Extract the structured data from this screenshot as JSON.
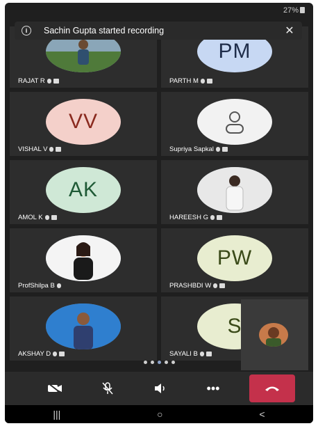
{
  "status": {
    "battery": "27%"
  },
  "banner": {
    "text": "Sachin Gupta started recording",
    "info_icon": "info-icon",
    "close_icon": "close-icon"
  },
  "colors": {
    "background": "#1f1f1f",
    "tile": "#2d2d2d",
    "end_call": "#c4314b"
  },
  "participants": [
    {
      "name": "RAJAT R",
      "avatar": "photo"
    },
    {
      "name": "PARTH M",
      "initials": "PM",
      "bg": "#c7d8f3",
      "fg": "#1f2d4a"
    },
    {
      "name": "VISHAL V",
      "initials": "VV",
      "bg": "#f4d0ca",
      "fg": "#8a2a1f"
    },
    {
      "name": "Supriya Sapkal",
      "avatar": "person-icon",
      "bg": "#f2f2f2"
    },
    {
      "name": "AMOL K",
      "initials": "AK",
      "bg": "#cfe8d6",
      "fg": "#1f5a36"
    },
    {
      "name": "HAREESH G",
      "avatar": "photo"
    },
    {
      "name": "ProfShilpa B",
      "avatar": "photo"
    },
    {
      "name": "PRASHBDI W",
      "initials": "PW",
      "bg": "#e8edd0",
      "fg": "#3a4a18"
    },
    {
      "name": "AKSHAY D",
      "avatar": "photo"
    },
    {
      "name": "SAYALI B",
      "initials": "S",
      "bg": "#e8edd0",
      "fg": "#3a4a18"
    }
  ],
  "pager": {
    "pages": 5,
    "active": 3
  },
  "toolbar": {
    "camera": "camera-off-icon",
    "mic": "mic-off-icon",
    "speaker": "speaker-icon",
    "more": "•••",
    "end": "end-call-icon"
  },
  "navbar": {
    "recent": "|||",
    "home": "○",
    "back": "<"
  }
}
